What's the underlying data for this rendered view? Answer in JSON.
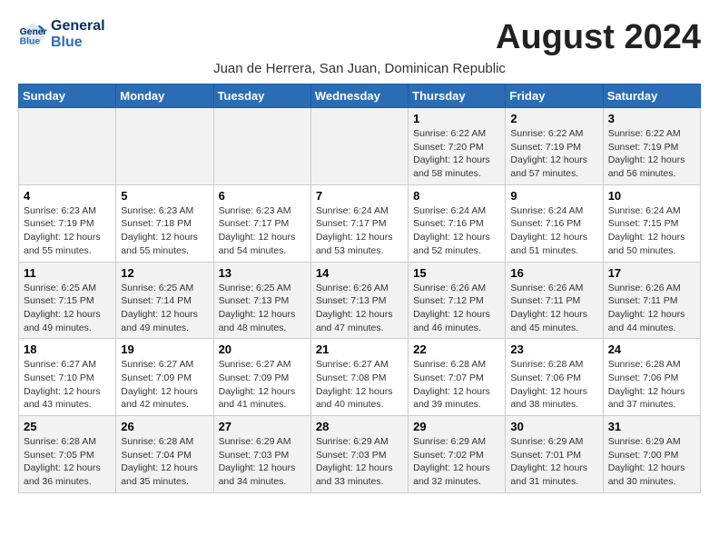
{
  "logo": {
    "line1": "General",
    "line2": "Blue"
  },
  "title": "August 2024",
  "subtitle": "Juan de Herrera, San Juan, Dominican Republic",
  "weekdays": [
    "Sunday",
    "Monday",
    "Tuesday",
    "Wednesday",
    "Thursday",
    "Friday",
    "Saturday"
  ],
  "weeks": [
    [
      {
        "day": "",
        "detail": ""
      },
      {
        "day": "",
        "detail": ""
      },
      {
        "day": "",
        "detail": ""
      },
      {
        "day": "",
        "detail": ""
      },
      {
        "day": "1",
        "detail": "Sunrise: 6:22 AM\nSunset: 7:20 PM\nDaylight: 12 hours\nand 58 minutes."
      },
      {
        "day": "2",
        "detail": "Sunrise: 6:22 AM\nSunset: 7:19 PM\nDaylight: 12 hours\nand 57 minutes."
      },
      {
        "day": "3",
        "detail": "Sunrise: 6:22 AM\nSunset: 7:19 PM\nDaylight: 12 hours\nand 56 minutes."
      }
    ],
    [
      {
        "day": "4",
        "detail": "Sunrise: 6:23 AM\nSunset: 7:19 PM\nDaylight: 12 hours\nand 55 minutes."
      },
      {
        "day": "5",
        "detail": "Sunrise: 6:23 AM\nSunset: 7:18 PM\nDaylight: 12 hours\nand 55 minutes."
      },
      {
        "day": "6",
        "detail": "Sunrise: 6:23 AM\nSunset: 7:17 PM\nDaylight: 12 hours\nand 54 minutes."
      },
      {
        "day": "7",
        "detail": "Sunrise: 6:24 AM\nSunset: 7:17 PM\nDaylight: 12 hours\nand 53 minutes."
      },
      {
        "day": "8",
        "detail": "Sunrise: 6:24 AM\nSunset: 7:16 PM\nDaylight: 12 hours\nand 52 minutes."
      },
      {
        "day": "9",
        "detail": "Sunrise: 6:24 AM\nSunset: 7:16 PM\nDaylight: 12 hours\nand 51 minutes."
      },
      {
        "day": "10",
        "detail": "Sunrise: 6:24 AM\nSunset: 7:15 PM\nDaylight: 12 hours\nand 50 minutes."
      }
    ],
    [
      {
        "day": "11",
        "detail": "Sunrise: 6:25 AM\nSunset: 7:15 PM\nDaylight: 12 hours\nand 49 minutes."
      },
      {
        "day": "12",
        "detail": "Sunrise: 6:25 AM\nSunset: 7:14 PM\nDaylight: 12 hours\nand 49 minutes."
      },
      {
        "day": "13",
        "detail": "Sunrise: 6:25 AM\nSunset: 7:13 PM\nDaylight: 12 hours\nand 48 minutes."
      },
      {
        "day": "14",
        "detail": "Sunrise: 6:26 AM\nSunset: 7:13 PM\nDaylight: 12 hours\nand 47 minutes."
      },
      {
        "day": "15",
        "detail": "Sunrise: 6:26 AM\nSunset: 7:12 PM\nDaylight: 12 hours\nand 46 minutes."
      },
      {
        "day": "16",
        "detail": "Sunrise: 6:26 AM\nSunset: 7:11 PM\nDaylight: 12 hours\nand 45 minutes."
      },
      {
        "day": "17",
        "detail": "Sunrise: 6:26 AM\nSunset: 7:11 PM\nDaylight: 12 hours\nand 44 minutes."
      }
    ],
    [
      {
        "day": "18",
        "detail": "Sunrise: 6:27 AM\nSunset: 7:10 PM\nDaylight: 12 hours\nand 43 minutes."
      },
      {
        "day": "19",
        "detail": "Sunrise: 6:27 AM\nSunset: 7:09 PM\nDaylight: 12 hours\nand 42 minutes."
      },
      {
        "day": "20",
        "detail": "Sunrise: 6:27 AM\nSunset: 7:09 PM\nDaylight: 12 hours\nand 41 minutes."
      },
      {
        "day": "21",
        "detail": "Sunrise: 6:27 AM\nSunset: 7:08 PM\nDaylight: 12 hours\nand 40 minutes."
      },
      {
        "day": "22",
        "detail": "Sunrise: 6:28 AM\nSunset: 7:07 PM\nDaylight: 12 hours\nand 39 minutes."
      },
      {
        "day": "23",
        "detail": "Sunrise: 6:28 AM\nSunset: 7:06 PM\nDaylight: 12 hours\nand 38 minutes."
      },
      {
        "day": "24",
        "detail": "Sunrise: 6:28 AM\nSunset: 7:06 PM\nDaylight: 12 hours\nand 37 minutes."
      }
    ],
    [
      {
        "day": "25",
        "detail": "Sunrise: 6:28 AM\nSunset: 7:05 PM\nDaylight: 12 hours\nand 36 minutes."
      },
      {
        "day": "26",
        "detail": "Sunrise: 6:28 AM\nSunset: 7:04 PM\nDaylight: 12 hours\nand 35 minutes."
      },
      {
        "day": "27",
        "detail": "Sunrise: 6:29 AM\nSunset: 7:03 PM\nDaylight: 12 hours\nand 34 minutes."
      },
      {
        "day": "28",
        "detail": "Sunrise: 6:29 AM\nSunset: 7:03 PM\nDaylight: 12 hours\nand 33 minutes."
      },
      {
        "day": "29",
        "detail": "Sunrise: 6:29 AM\nSunset: 7:02 PM\nDaylight: 12 hours\nand 32 minutes."
      },
      {
        "day": "30",
        "detail": "Sunrise: 6:29 AM\nSunset: 7:01 PM\nDaylight: 12 hours\nand 31 minutes."
      },
      {
        "day": "31",
        "detail": "Sunrise: 6:29 AM\nSunset: 7:00 PM\nDaylight: 12 hours\nand 30 minutes."
      }
    ]
  ]
}
